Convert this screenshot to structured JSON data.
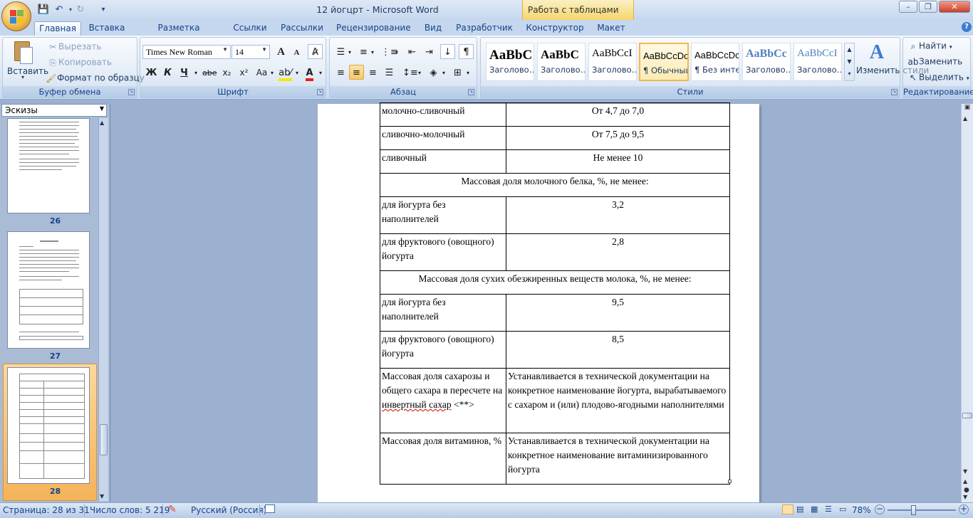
{
  "window": {
    "title": "12 йогцрт - Microsoft Word",
    "context_tab": "Работа с таблицами",
    "minimize": "–",
    "maximize": "❐",
    "close": "✕"
  },
  "qat": {
    "save": "💾",
    "undo": "↶",
    "redo": "↻",
    "more": "▾"
  },
  "tabs": [
    "Главная",
    "Вставка",
    "Разметка страницы",
    "Ссылки",
    "Рассылки",
    "Рецензирование",
    "Вид",
    "Разработчик",
    "Конструктор",
    "Макет"
  ],
  "help_icon": "?",
  "clipboard": {
    "paste": "Вставить",
    "cut": "Вырезать",
    "copy": "Копировать",
    "format_painter": "Формат по образцу",
    "label": "Буфер обмена"
  },
  "font": {
    "name": "Times New Roman",
    "size": "14",
    "bold": "Ж",
    "italic": "К",
    "underline": "Ч",
    "strike": "abe",
    "subscript": "x₂",
    "superscript": "x²",
    "case": "Aa",
    "grow": "A",
    "shrink": "A",
    "label": "Шрифт"
  },
  "paragraph": {
    "label": "Абзац"
  },
  "styles": {
    "items": [
      {
        "sample": "AaBbC",
        "name": "Заголово..."
      },
      {
        "sample": "AaBbC",
        "name": "Заголово..."
      },
      {
        "sample": "AaBbCcI",
        "name": "Заголово..."
      },
      {
        "sample": "AaBbCcDc",
        "name": "¶ Обычный"
      },
      {
        "sample": "AaBbCcDc",
        "name": "¶ Без инте..."
      },
      {
        "sample": "AaBbCc",
        "name": "Заголово..."
      },
      {
        "sample": "AaBbCcI",
        "name": "Заголово..."
      }
    ],
    "change": "Изменить стили",
    "label": "Стили"
  },
  "editing": {
    "find": "Найти",
    "replace": "Заменить",
    "select": "Выделить",
    "label": "Редактирование"
  },
  "nav": {
    "mode": "Эскизы",
    "pages": [
      "26",
      "27",
      "28"
    ]
  },
  "table": {
    "rows": [
      {
        "type": "pair",
        "c1": "молочно-сливочный",
        "c2": "От 4,7 до 7,0"
      },
      {
        "type": "pair",
        "c1": "сливочно-молочный",
        "c2": "От 7,5 до 9,5"
      },
      {
        "type": "pair",
        "c1": "сливочный",
        "c2": "Не менее 10"
      },
      {
        "type": "span",
        "c1": "Массовая доля молочного белка, %, не менее:"
      },
      {
        "type": "pair",
        "c1": "для йогурта без наполнителей",
        "c2": "3,2"
      },
      {
        "type": "pair",
        "c1": "для фруктового (овощного) йогурта",
        "c2": "2,8"
      },
      {
        "type": "span",
        "c1": "Массовая доля сухих обезжиренных веществ молока, %, не менее:"
      },
      {
        "type": "pair",
        "c1": "для йогурта без наполнителей",
        "c2": "9,5"
      },
      {
        "type": "pair",
        "c1": "для фруктового (овощного) йогурта",
        "c2": "8,5"
      },
      {
        "type": "pairleft",
        "c1a": "Массовая доля сахарозы и общего сахара в пересчете на ",
        "c1b": "инвертный сахар",
        "c1c": " <**>",
        "c2": "Устанавливается в технической документации на конкретное наименование йогурта, вырабатываемого с сахаром и (или) плодово-ягодными наполнителями"
      },
      {
        "type": "pairleft2",
        "c1": "Массовая доля витаминов, %",
        "c2": "Устанавливается в технической документации на конкретное наименование витаминизированного йогурта"
      }
    ]
  },
  "status": {
    "page": "Страница: 28 из 31",
    "words": "Число слов: 5 219",
    "language": "Русский (Россия)",
    "zoom": "78%",
    "zoom_level_percent": 78
  }
}
